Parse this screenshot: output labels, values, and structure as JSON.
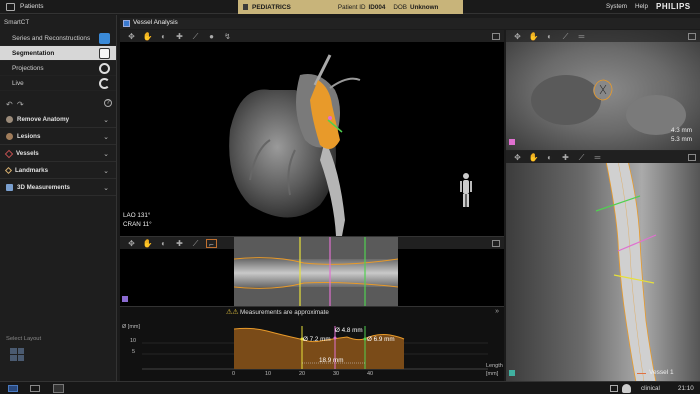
{
  "topbar": {
    "patients_label": "Patients",
    "patient_type": "PEDIATRICS",
    "patient_id_label": "Patient ID",
    "patient_id": "ID004",
    "dob_label": "DOB",
    "dob_value": "Unknown",
    "system_label": "System",
    "help_label": "Help",
    "brand": "PHILIPS"
  },
  "sidebar": {
    "app_title": "SmartCT",
    "nav_items": [
      {
        "label": "Series and Reconstructions",
        "icon": "cube-blue-icon"
      },
      {
        "label": "Segmentation",
        "icon": "cube-white-icon"
      },
      {
        "label": "Projections",
        "icon": "rotate-icon"
      },
      {
        "label": "Live",
        "icon": "refresh-icon"
      }
    ],
    "undo_label": "↶",
    "redo_label": "↷",
    "help_symbol": "?",
    "accordion": [
      {
        "label": "Remove Anatomy",
        "color": "#9b8b7a"
      },
      {
        "label": "Lesions",
        "color": "#a07c5a"
      },
      {
        "label": "Vessels",
        "color": "#c05050"
      },
      {
        "label": "Landmarks",
        "color": "#d8b070"
      },
      {
        "label": "3D Measurements",
        "color": "#7aa0d0"
      }
    ],
    "select_layout_label": "Select Layout"
  },
  "vessel_window": {
    "title": "Vessel Analysis",
    "view_orientation_line1": "LAO 131°",
    "view_orientation_line2": "CRAN  11°",
    "warning_text": "Measurements are approximate",
    "warning_icons": "⚠⚠",
    "graph": {
      "y_axis_label": "Ø [mm]",
      "y_ticks": [
        "10",
        "5"
      ],
      "x_ticks": [
        "0",
        "10",
        "20",
        "30",
        "40"
      ],
      "length_label": "Length",
      "length_unit": "[mm]",
      "measure_1": "Ø 7.2 mm",
      "measure_2": "Ø 4.8 mm",
      "measure_3": "Ø 6.9 mm",
      "span_label": "18.9 mm"
    },
    "cross_section_measure_1": "4.3 mm",
    "cross_section_measure_2": "5.3 mm",
    "vessel_legend": "Vessel 1"
  },
  "statusbar": {
    "user": "clinical",
    "time": "21:10"
  },
  "colors": {
    "accent_orange": "#e89a2a",
    "marker_yellow": "#e6e03a",
    "marker_pink": "#e070d0",
    "marker_green": "#50d050",
    "header_gold": "#c8b47a"
  }
}
